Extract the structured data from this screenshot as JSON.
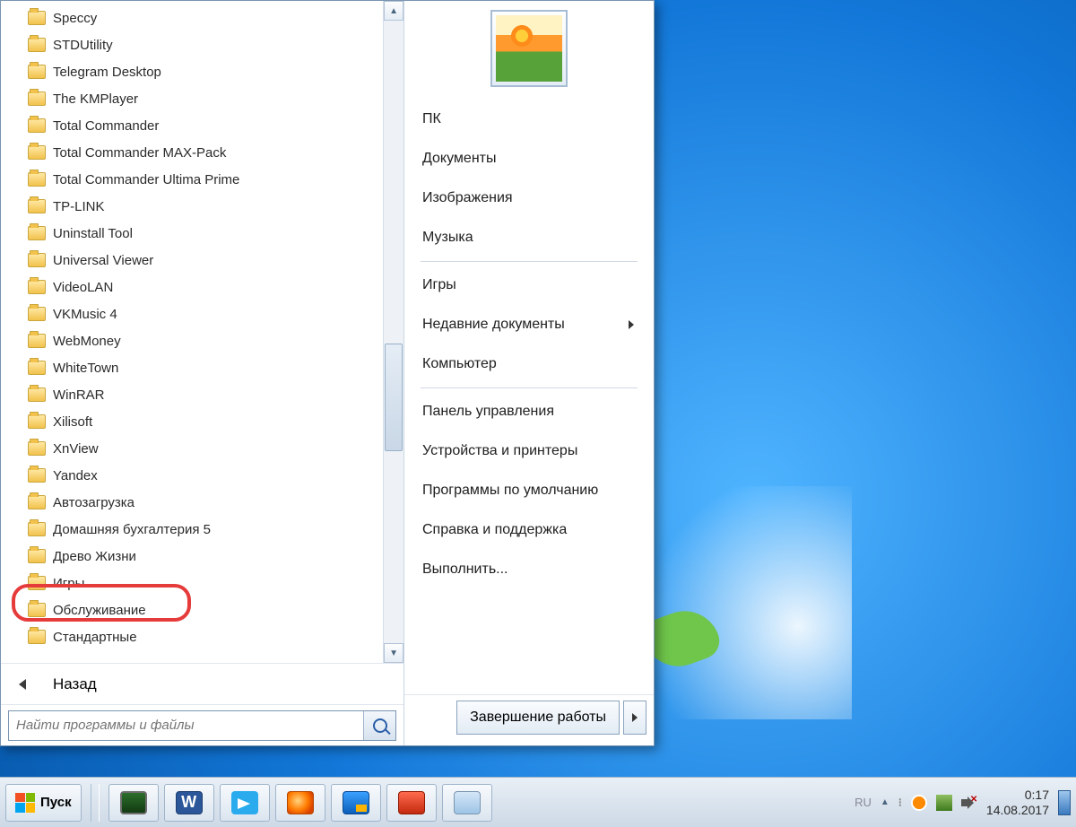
{
  "programs": [
    "Speccy",
    "STDUtility",
    "Telegram Desktop",
    "The KMPlayer",
    "Total Commander",
    "Total Commander MAX-Pack",
    "Total Commander Ultima Prime",
    "TP-LINK",
    "Uninstall Tool",
    "Universal Viewer",
    "VideoLAN",
    "VKMusic 4",
    "WebMoney",
    "WhiteTown",
    "WinRAR",
    "Xilisoft",
    "XnView",
    "Yandex",
    "Автозагрузка",
    "Домашняя бухгалтерия 5",
    "Древо Жизни",
    "Игры",
    "Обслуживание",
    "Стандартные"
  ],
  "highlight_index": 23,
  "back_label": "Назад",
  "search_placeholder": "Найти программы и файлы",
  "right_groups": [
    {
      "items": [
        {
          "label": "ПК"
        },
        {
          "label": "Документы"
        },
        {
          "label": "Изображения"
        },
        {
          "label": "Музыка"
        }
      ]
    },
    {
      "items": [
        {
          "label": "Игры"
        },
        {
          "label": "Недавние документы",
          "submenu": true
        },
        {
          "label": "Компьютер"
        }
      ]
    },
    {
      "items": [
        {
          "label": "Панель управления"
        },
        {
          "label": "Устройства и принтеры"
        },
        {
          "label": "Программы по умолчанию"
        },
        {
          "label": "Справка и поддержка"
        },
        {
          "label": "Выполнить..."
        }
      ]
    }
  ],
  "shutdown_label": "Завершение работы",
  "start_label": "Пуск",
  "taskbar_icons": [
    {
      "name": "task-manager",
      "cls": "ic-monitor"
    },
    {
      "name": "word",
      "cls": "ic-word",
      "text": "W"
    },
    {
      "name": "telegram",
      "cls": "ic-tel"
    },
    {
      "name": "firefox",
      "cls": "ic-ff"
    },
    {
      "name": "settings",
      "cls": "ic-set"
    },
    {
      "name": "toolbox",
      "cls": "ic-box"
    },
    {
      "name": "explorer",
      "cls": "ic-win"
    }
  ],
  "clock": {
    "time": "0:17",
    "date": "14.08.2017"
  },
  "lang": "RU"
}
